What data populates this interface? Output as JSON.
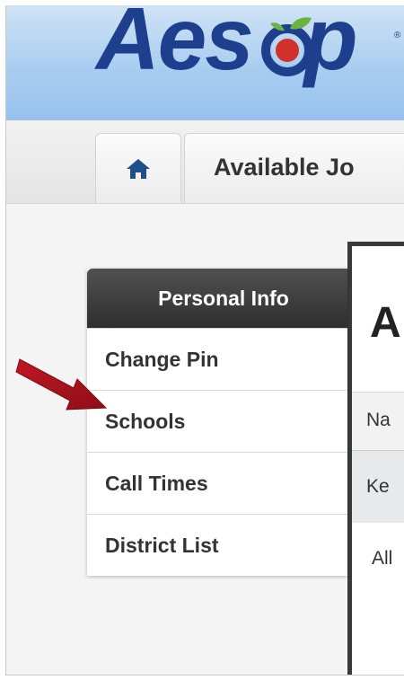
{
  "header": {
    "logo_text_left": "Aes",
    "logo_text_right": "p",
    "colors": {
      "logo_blue": "#1d3f8e",
      "apple_red": "#d2302a",
      "leaf_green": "#6cb33f"
    }
  },
  "nav": {
    "home_icon": "home-icon",
    "jobs_tab_label": "Available Jo"
  },
  "sidebar": {
    "header_label": "Personal Info",
    "items": [
      {
        "label": "Change Pin"
      },
      {
        "label": "Schools"
      },
      {
        "label": "Call Times"
      },
      {
        "label": "District List"
      }
    ]
  },
  "main": {
    "title": "A",
    "column_header": "Na",
    "rows": [
      "Ke",
      "All"
    ]
  },
  "annotation": {
    "arrow_color": "#a3111c"
  }
}
